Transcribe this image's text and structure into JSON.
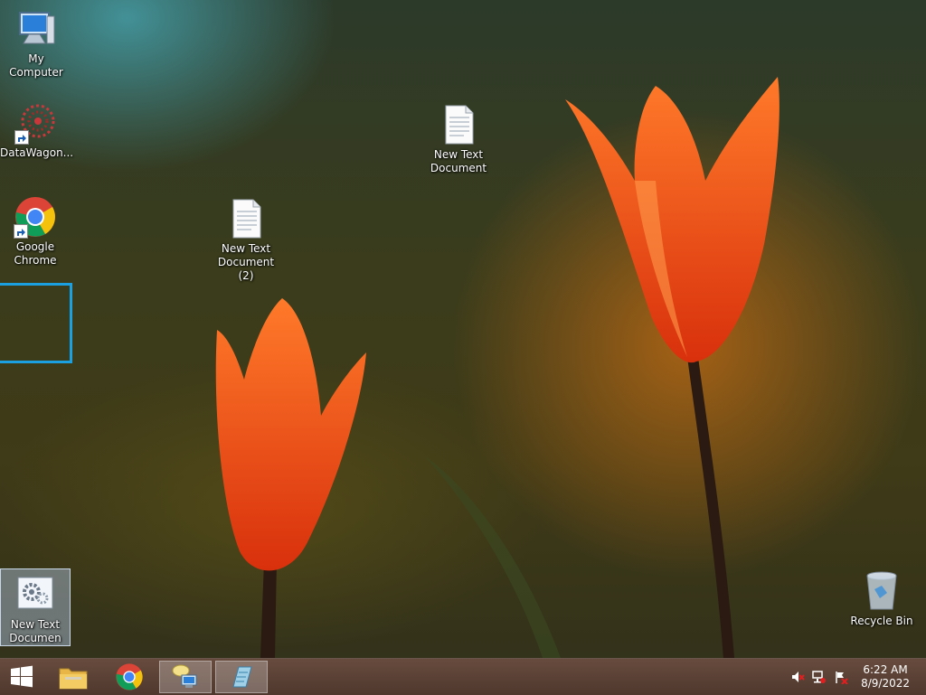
{
  "desktop": {
    "icons": [
      {
        "label": "My Computer",
        "icon": "computer-icon"
      },
      {
        "label": "DataWagon...",
        "icon": "datawagon-icon"
      },
      {
        "label": "Google Chrome",
        "icon": "chrome-icon"
      },
      {
        "label": "New Text Document (2)",
        "icon": "text-document-icon"
      },
      {
        "label": "New Text Document",
        "icon": "text-document-icon"
      },
      {
        "label": "New Text Documen",
        "icon": "settings-document-icon"
      },
      {
        "label": "Recycle Bin",
        "icon": "recycle-bin-icon"
      }
    ]
  },
  "taskbar": {
    "buttons": [
      {
        "name": "start",
        "icon": "windows-logo-icon"
      },
      {
        "name": "file-explorer",
        "icon": "folder-icon"
      },
      {
        "name": "chrome",
        "icon": "chrome-icon"
      },
      {
        "name": "network-app",
        "icon": "network-computer-icon"
      },
      {
        "name": "notepad",
        "icon": "notepad-icon"
      }
    ],
    "tray": [
      "volume-muted-icon",
      "network-icon",
      "action-center-flag-icon"
    ],
    "clock": {
      "time": "6:22 AM",
      "date": "8/9/2022"
    }
  },
  "colors": {
    "accent": "#1ba1e2",
    "taskbar": "#5a3c2d"
  }
}
